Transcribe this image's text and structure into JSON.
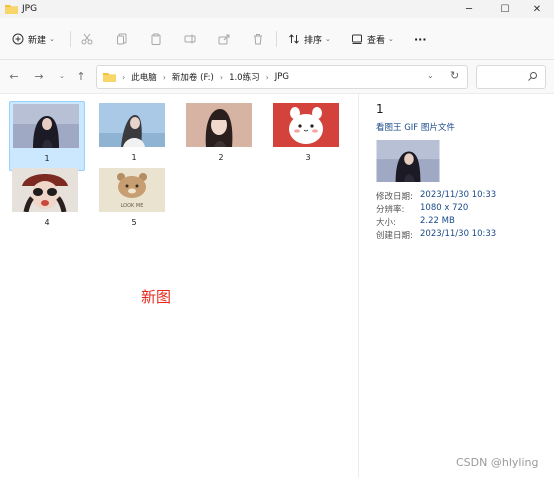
{
  "window": {
    "title": "JPG"
  },
  "toolbar": {
    "new_label": "新建",
    "sort_label": "排序",
    "view_label": "查看",
    "more_label": "···"
  },
  "address": {
    "crumbs": [
      "此电脑",
      "新加卷 (F:)",
      "1.0练习",
      "JPG"
    ]
  },
  "files": [
    {
      "name": "1",
      "selected": true
    },
    {
      "name": "1",
      "selected": false
    },
    {
      "name": "2",
      "selected": false
    },
    {
      "name": "3",
      "selected": false
    },
    {
      "name": "4",
      "selected": false
    },
    {
      "name": "5",
      "selected": false
    }
  ],
  "annotation": "新图",
  "details": {
    "name": "1",
    "type": "看图王 GIF 图片文件",
    "rows": [
      {
        "key": "修改日期:",
        "value": "2023/11/30 10:33"
      },
      {
        "key": "分辨率:",
        "value": "1080 x 720"
      },
      {
        "key": "大小:",
        "value": "2.22 MB"
      },
      {
        "key": "创建日期:",
        "value": "2023/11/30 10:33"
      }
    ]
  },
  "thumb5_text": "LOOK ME",
  "watermark": "CSDN @hlyling",
  "colors": {
    "selection": "#cce8ff",
    "accent": "#1a4a8a",
    "annotation": "#e8281e",
    "folder": "#f4c13a"
  }
}
